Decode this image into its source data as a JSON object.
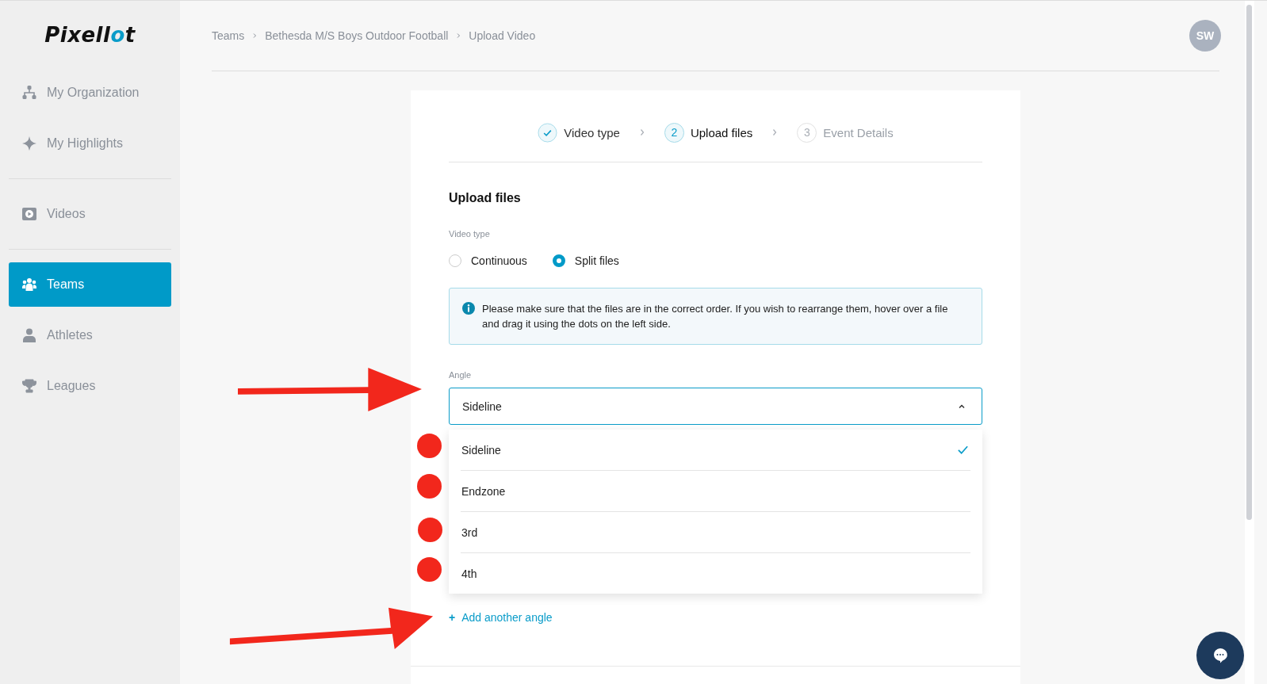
{
  "sidebar": {
    "logo": {
      "text_main": "Pixell",
      "text_accent": "o",
      "text_end": "t"
    },
    "groups": [
      {
        "items": [
          {
            "label": "My Organization",
            "selected": false
          },
          {
            "label": "My Highlights",
            "selected": false
          }
        ]
      },
      {
        "items": [
          {
            "label": "Videos",
            "selected": false
          }
        ]
      },
      {
        "items": [
          {
            "label": "Teams",
            "selected": true
          },
          {
            "label": "Athletes",
            "selected": false
          },
          {
            "label": "Leagues",
            "selected": false
          }
        ]
      }
    ]
  },
  "breadcrumb": [
    "Teams",
    "Bethesda M/S Boys Outdoor Football",
    "Upload Video"
  ],
  "avatar": {
    "initials": "SW"
  },
  "stepper": [
    {
      "label": "Video type",
      "completed": true,
      "selected": false
    },
    {
      "number": "2",
      "label": "Upload files",
      "completed": false,
      "selected": true
    },
    {
      "number": "3",
      "label": "Event Details",
      "completed": false,
      "selected": false
    }
  ],
  "form": {
    "title": "Upload files",
    "video_type_label": "Video type",
    "video_types": [
      {
        "label": "Continuous",
        "selected": false
      },
      {
        "label": "Split files",
        "selected": true
      }
    ],
    "info": "Please make sure that the files are in the correct order. If you wish to rearrange them, hover over a file and drag it using the dots on the left side.",
    "angle_label": "Angle",
    "angle_value": "Sideline",
    "angle_expanded": true,
    "angle_options": [
      {
        "label": "Sideline",
        "selected": true
      },
      {
        "label": "Endzone",
        "selected": false
      },
      {
        "label": "3rd",
        "selected": false
      },
      {
        "label": "4th",
        "selected": false
      }
    ],
    "add_angle": "Add another angle",
    "add_icon": "+"
  }
}
